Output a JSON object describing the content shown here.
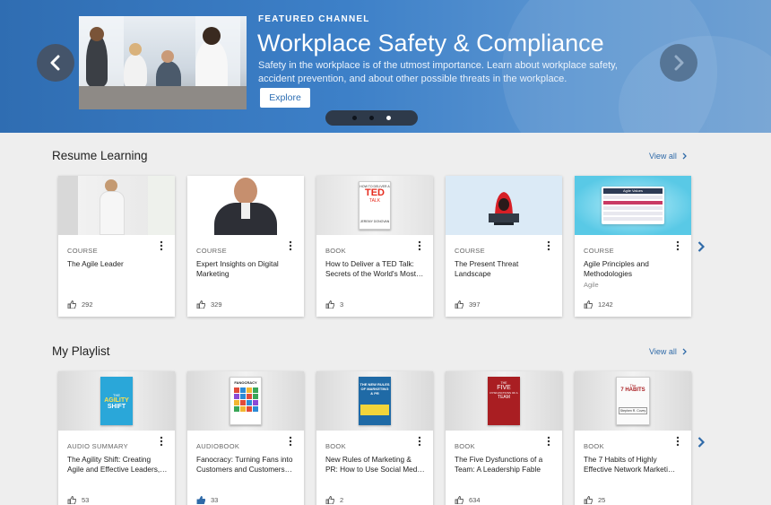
{
  "hero": {
    "label": "FEATURED CHANNEL",
    "title": "Workplace Safety & Compliance",
    "description": "Safety in the workplace is of the utmost importance. Learn about workplace safety, accident prevention, and about other possible threats in the workplace.",
    "button": "Explore",
    "slides": 3,
    "active_slide": 3
  },
  "resume": {
    "title": "Resume Learning",
    "view_all": "View all",
    "cards": [
      {
        "type": "COURSE",
        "title": "The Agile Leader",
        "subtitle": "",
        "likes": "292"
      },
      {
        "type": "COURSE",
        "title": "Expert Insights on Digital Marketing",
        "subtitle": "",
        "likes": "329"
      },
      {
        "type": "BOOK",
        "title": "How to Deliver a TED Talk: Secrets of the World's Most…",
        "subtitle": "",
        "likes": "3"
      },
      {
        "type": "COURSE",
        "title": "The Present Threat Landscape",
        "subtitle": "",
        "likes": "397"
      },
      {
        "type": "COURSE",
        "title": "Agile Principles and Methodologies",
        "subtitle": "Agile",
        "likes": "1242"
      }
    ]
  },
  "playlist": {
    "title": "My Playlist",
    "view_all": "View all",
    "cards": [
      {
        "type": "AUDIO SUMMARY",
        "title": "The Agility Shift: Creating Agile and Effective Leaders,…",
        "likes": "53"
      },
      {
        "type": "AUDIOBOOK",
        "title": "Fanocracy: Turning Fans into Customers and Customers…",
        "likes": "33"
      },
      {
        "type": "BOOK",
        "title": "New Rules of Marketing & PR: How to Use Social Med…",
        "likes": "2"
      },
      {
        "type": "BOOK",
        "title": "The Five Dysfunctions of a Team: A Leadership Fable",
        "likes": "634"
      },
      {
        "type": "BOOK",
        "title": "The 7 Habits of Highly Effective Network Marketi…",
        "likes": "25"
      }
    ]
  },
  "thumbs": {
    "ted_book": {
      "line1": "HOW TO DELIVER A",
      "brand": "TED",
      "brand2": "TALK",
      "author": "JEREMY DONOVAN"
    },
    "agility_book": {
      "line1": "THE",
      "line2": "AGILITY",
      "line3": "SHIFT"
    },
    "fanocracy_book": {
      "line1": "FANOCRACY"
    },
    "new_rules_book": {
      "line1": "THE NEW RULES",
      "line2": "OF MARKETING",
      "line3": "& PR"
    },
    "five_book": {
      "line1": "THE",
      "line2": "FIVE",
      "line3": "DYSFUNCTIONS OF A",
      "line4": "TEAM"
    },
    "habits_book": {
      "line1": "The",
      "line2": "7 HABITS",
      "author": "Stephen R. Covey"
    },
    "agile_slide": {
      "header": "Agile Values"
    }
  },
  "colors": {
    "accent": "#2f6aa8",
    "hero": "#3d80c8",
    "like_active": "#2f6aa8"
  }
}
